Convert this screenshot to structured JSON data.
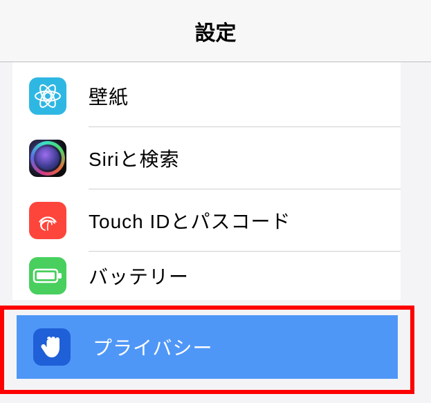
{
  "header": {
    "title": "設定"
  },
  "items": [
    {
      "label": "壁紙",
      "icon": "wallpaper-icon",
      "bg": "#2fb7e3"
    },
    {
      "label": "Siriと検索",
      "icon": "siri-icon",
      "bg": "#000000"
    },
    {
      "label": "Touch IDとパスコード",
      "icon": "fingerprint-icon",
      "bg": "#fe453b"
    },
    {
      "label": "バッテリー",
      "icon": "battery-icon",
      "bg": "#48cf5e"
    },
    {
      "label": "プライバシー",
      "icon": "hand-icon",
      "bg": "#1f5fd7"
    }
  ],
  "selected_index": 4
}
